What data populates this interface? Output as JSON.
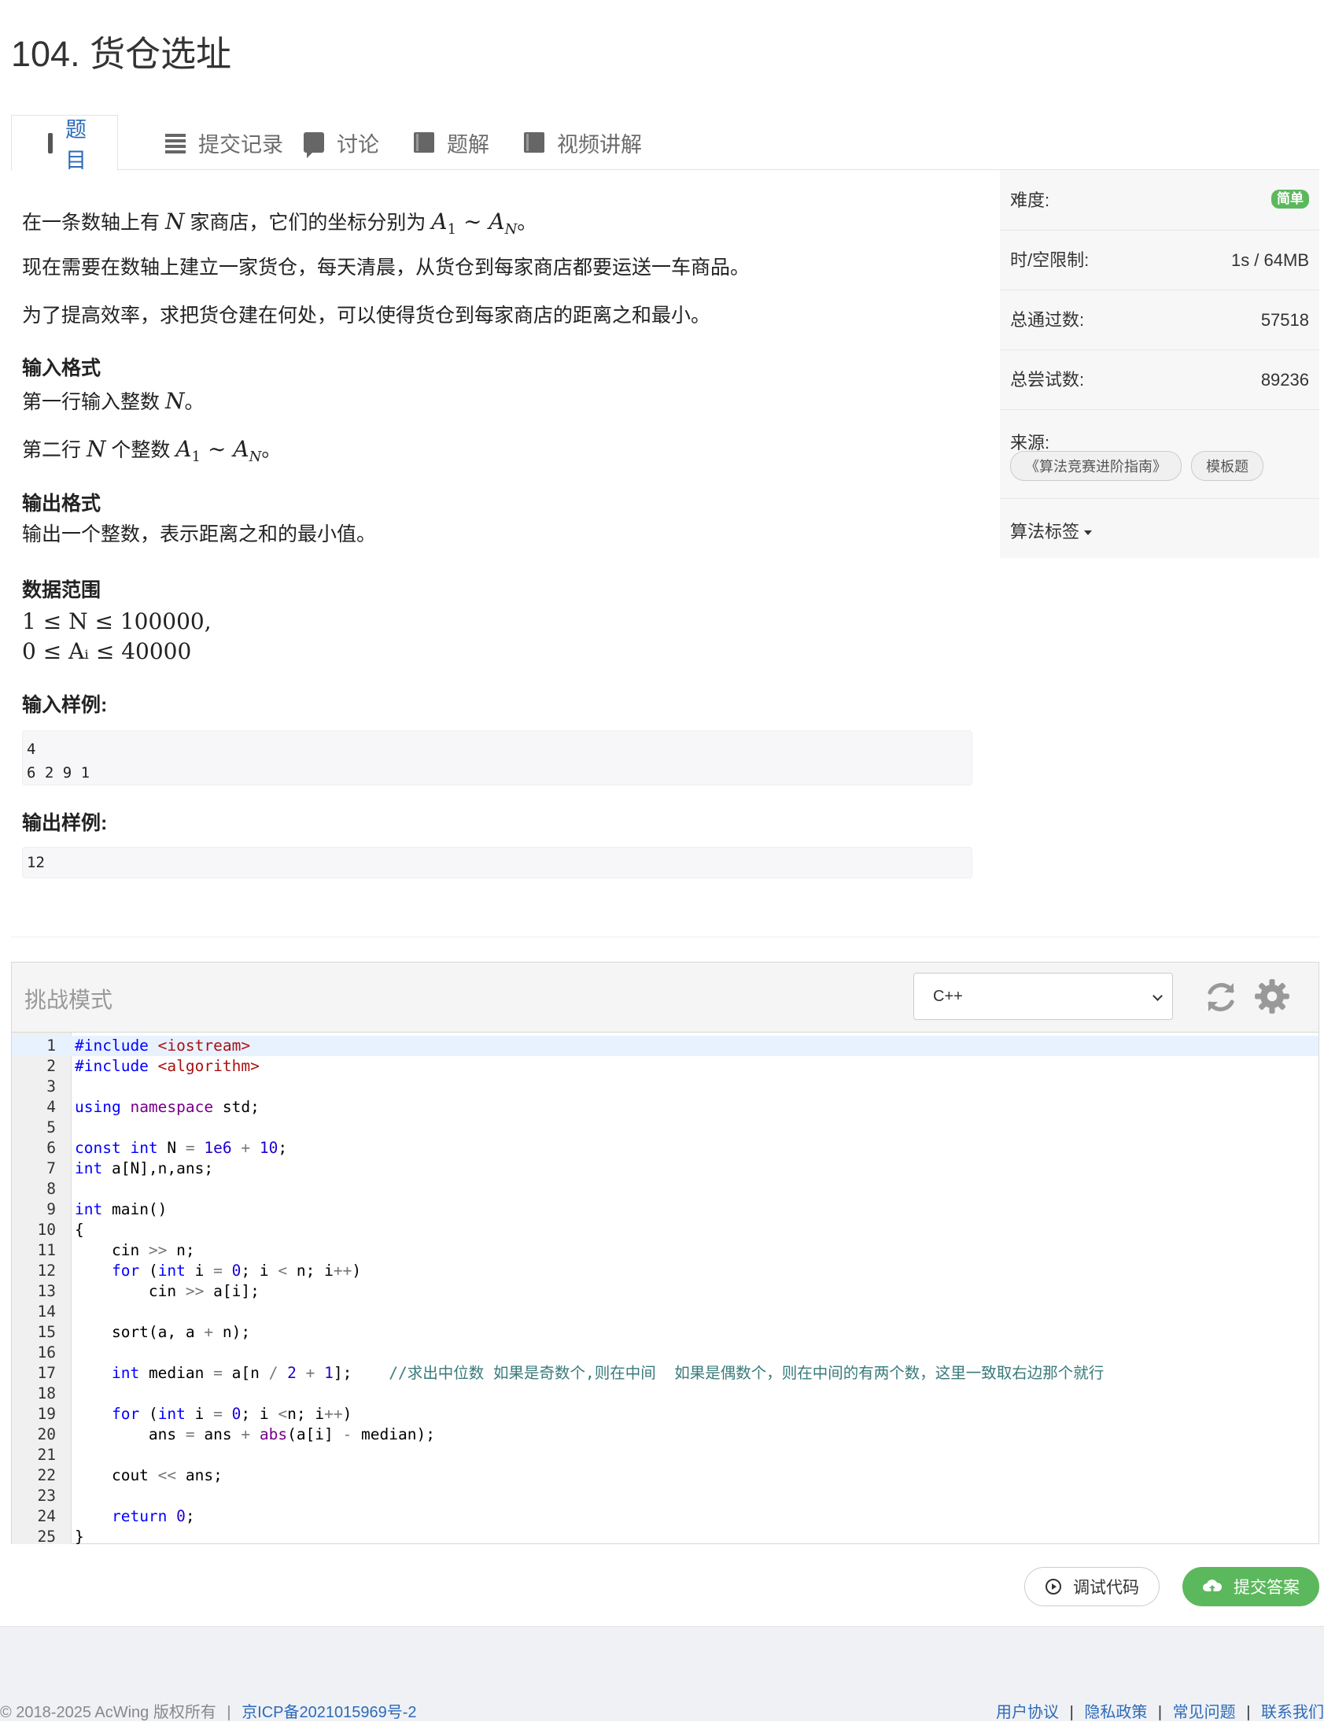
{
  "page_title": "104. 货仓选址",
  "tabs": [
    {
      "label": "题目",
      "icon": "document-icon"
    },
    {
      "label": "提交记录",
      "icon": "list-icon"
    },
    {
      "label": "讨论",
      "icon": "comment-icon"
    },
    {
      "label": "题解",
      "icon": "book-icon"
    },
    {
      "label": "视频讲解",
      "icon": "book-icon"
    }
  ],
  "problem": {
    "p1_pre": "在一条数轴上有",
    "p1_mid": "家商店，它们的坐标分别为",
    "p1_end": "。",
    "var_N": "N",
    "var_A1": "A",
    "sub_1": "1",
    "tilde": " ∼ ",
    "var_AN": "A",
    "sub_N": "N",
    "p2": "现在需要在数轴上建立一家货仓，每天清晨，从货仓到每家商店都要运送一车商品。",
    "p3": "为了提高效率，求把货仓建在何处，可以使得货仓到每家商店的距离之和最小。",
    "input_format_title": "输入格式",
    "input_line1_pre": "第一行输入整数",
    "input_line1_end": "。",
    "input_line2_pre": "第二行",
    "input_line2_mid": "个整数",
    "input_line2_end": "。",
    "output_format_title": "输出格式",
    "output_line": "输出一个整数，表示距离之和的最小值。",
    "range_title": "数据范围",
    "range1": "1 ≤ N ≤ 100000,",
    "range2": "0 ≤ Aᵢ ≤ 40000",
    "sample_in_title": "输入样例:",
    "sample_in": [
      "4",
      "6 2 9 1"
    ],
    "sample_out_title": "输出样例:",
    "sample_out": [
      "12"
    ]
  },
  "side": {
    "difficulty_label": "难度:",
    "difficulty_value": "简单",
    "limit_label": "时/空限制:",
    "limit_value": "1s / 64MB",
    "passed_label": "总通过数:",
    "passed_value": "57518",
    "tried_label": "总尝试数:",
    "tried_value": "89236",
    "source_label": "来源:",
    "source_tags": [
      "《算法竞赛进阶指南》",
      "模板题"
    ],
    "algo_tags_label": "算法标签"
  },
  "editor": {
    "mode_label": "挑战模式",
    "language": "C++",
    "code_lines": [
      "#include <iostream>",
      "#include <algorithm>",
      "",
      "using namespace std;",
      "",
      "const int N = 1e6 + 10;",
      "int a[N],n,ans;",
      "",
      "int main()",
      "{",
      "    cin >> n;",
      "    for (int i = 0; i < n; i++)",
      "        cin >> a[i];",
      "",
      "    sort(a, a + n);",
      "",
      "    int median = a[n / 2 + 1];    //求出中位数 如果是奇数个,则在中间  如果是偶数个，则在中间的有两个数，这里一致取右边那个就行",
      "",
      "    for (int i = 0; i <n; i++)",
      "        ans = ans + abs(a[i] - median);",
      "",
      "    cout << ans;",
      "",
      "    return 0;",
      "}"
    ]
  },
  "actions": {
    "debug_label": "调试代码",
    "submit_label": "提交答案"
  },
  "footer": {
    "copyright": "© 2018-2025 AcWing 版权所有",
    "separator": "|",
    "icp": "京ICP备2021015969号-2",
    "links": [
      "用户协议",
      "隐私政策",
      "常见问题",
      "联系我们"
    ]
  },
  "colors": {
    "accent_blue": "#2b6bb8",
    "success_green": "#5cb85c"
  }
}
